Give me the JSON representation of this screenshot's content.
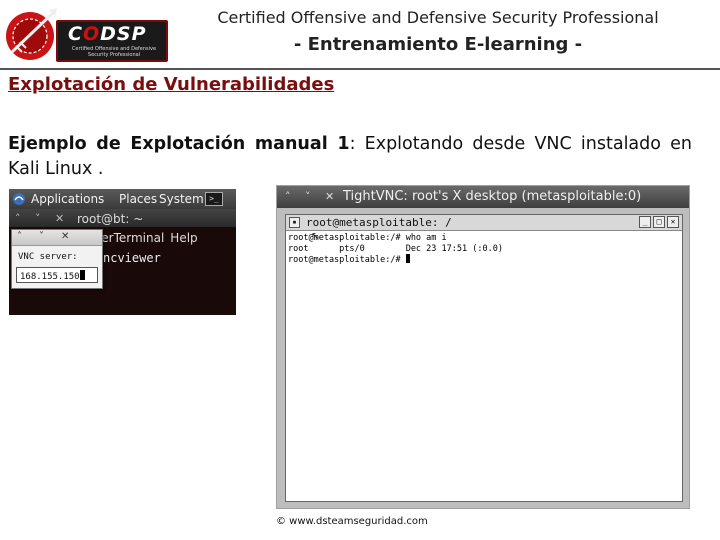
{
  "header": {
    "logo_text_c": "C",
    "logo_text_o": "O",
    "logo_text_rest": "DSP",
    "logo_subtitle": "Certified Offensive and Defensive Security Professional",
    "title": "Certified Offensive and Defensive Security Professional",
    "subtitle": "- Entrenamiento E-learning -"
  },
  "section_title": "Explotación de Vulnerabilidades",
  "body": {
    "bold_part": "Ejemplo de Explotación manual 1",
    "normal_part": ": Explotando desde VNC instalado en Kali Linux ."
  },
  "kali": {
    "menu": [
      "Applications",
      "Places",
      "System"
    ],
    "window_title": "root@bt: ~",
    "inner_menu": [
      "Terminal",
      "Help"
    ],
    "inner_prefix": "ser",
    "command": "ncviewer",
    "dialog": {
      "label": "VNC server:",
      "value": "168.155.150"
    }
  },
  "vnc": {
    "title": "TightVNC: root's X desktop (metasploitable:0)",
    "xterm_title": "root@metasploitable: /",
    "lines": [
      "root@metasploitable:/# who am i",
      "root      pts/0        Dec 23 17:51 (:0.0)",
      "root@metasploitable:/# "
    ]
  },
  "footer": "© www.dsteamseguridad.com",
  "colors": {
    "section_title": "#7a0d0d",
    "logo_red": "#d01010"
  }
}
